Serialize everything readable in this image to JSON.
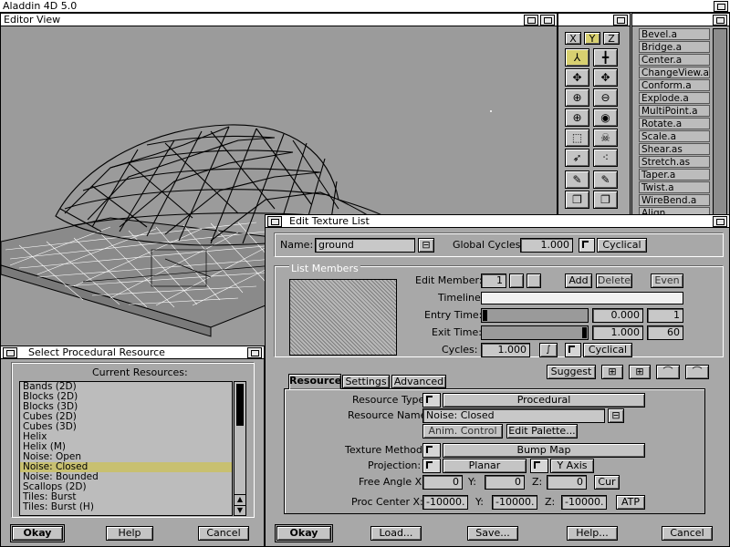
{
  "app": {
    "title": "Aladdin 4D 5.0"
  },
  "editor": {
    "title": "Editor View"
  },
  "tools": {
    "axes": [
      "X",
      "Y",
      "Z"
    ]
  },
  "modifiers": [
    "Bevel.a",
    "Bridge.a",
    "Center.a",
    "ChangeView.a",
    "Conform.a",
    "Explode.a",
    "MultiPoint.a",
    "Rotate.a",
    "Scale.a",
    "Shear.as",
    "Stretch.as",
    "Taper.a",
    "Twist.a",
    "WireBend.a",
    "Align"
  ],
  "procedural": {
    "title": "Select Procedural Resource",
    "heading": "Current Resources:",
    "items": [
      "Bands (2D)",
      "Blocks (2D)",
      "Blocks (3D)",
      "Cubes (2D)",
      "Cubes (3D)",
      "Helix",
      "Helix (M)",
      "Noise: Open",
      "Noise: Closed",
      "Noise: Bounded",
      "Scallops (2D)",
      "Tiles: Burst",
      "Tiles: Burst (H)"
    ],
    "selected": "Noise: Closed",
    "okay": "Okay",
    "help": "Help",
    "cancel": "Cancel"
  },
  "texture": {
    "title": "Edit Texture List",
    "name_label": "Name:",
    "name_value": "ground",
    "global_cycles_label": "Global Cycles:",
    "global_cycles_value": "1.000",
    "cyclical": "Cyclical",
    "list_members": "List Members",
    "edit_member_label": "Edit Member:",
    "edit_member_value": "1",
    "add": "Add",
    "delete": "Delete",
    "even": "Even",
    "timeline_label": "Timeline:",
    "entry_label": "Entry Time:",
    "entry_value": "0.000",
    "entry_frame": "1",
    "exit_label": "Exit Time:",
    "exit_value": "1.000",
    "exit_frame": "60",
    "cycles_label": "Cycles:",
    "cycles_value": "1.000",
    "cycles_mode": "Cyclical",
    "suggest": "Suggest",
    "tabs": [
      "Resource",
      "Settings",
      "Advanced"
    ],
    "resource_type_label": "Resource Type:",
    "resource_type_value": "Procedural",
    "resource_name_label": "Resource Name:",
    "resource_name_value": "Noise: Closed",
    "anim_control": "Anim. Control",
    "edit_palette": "Edit Palette...",
    "texture_method_label": "Texture Method:",
    "texture_method_value": "Bump Map",
    "projection_label": "Projection:",
    "projection_value": "Planar",
    "projection_axis": "Y Axis",
    "free_angle_label": "Free Angle X:",
    "fa_x": "0",
    "y_label": "Y:",
    "fa_y": "0",
    "z_label": "Z:",
    "fa_z": "0",
    "cur": "Cur",
    "proc_center_label": "Proc Center X:",
    "pc_x": "-10000.",
    "pc_y": "-10000.",
    "pc_z": "-10000.",
    "atp": "ATP",
    "okay": "Okay",
    "load": "Load...",
    "save": "Save...",
    "help": "Help...",
    "cancel": "Cancel"
  }
}
